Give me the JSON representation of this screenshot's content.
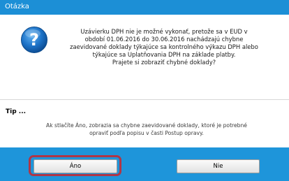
{
  "dialog": {
    "title": "Otázka",
    "icon": "question-icon",
    "message": "Uzávierku DPH nie je možné vykonať, pretože sa v EUD v\nobdobí 01.06.2016 do 30.06.2016 nachádzajú chybne\nzaevidované doklady týkajúce sa kontrolného výkazu DPH alebo\ntýkajúce sa Uplatňovania DPH na základe platby.\nPrajete si zobraziť chybné doklady?",
    "tip_heading": "Tip ...",
    "tip_text": "Ak stlačíte Áno, zobrazia sa chybne zaevidované doklady, ktoré je potrebné\nopraviť podľa popisu v časti Postup opravy.",
    "buttons": {
      "yes_label": "Áno",
      "no_label": "Nie"
    }
  },
  "colors": {
    "titlebar": "#1c8fd6",
    "footer": "#1e95da",
    "highlight": "#b03646",
    "icon_blue": "#1d73c8"
  }
}
